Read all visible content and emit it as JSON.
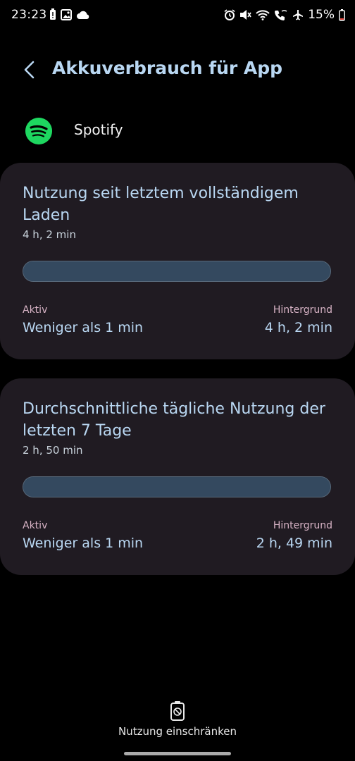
{
  "status_bar": {
    "time": "23:23",
    "battery_percent": "15%",
    "icons_left": [
      "battery-alert-icon",
      "image-icon",
      "cloud-icon"
    ],
    "icons_right": [
      "alarm-icon",
      "mute-icon",
      "wifi-icon",
      "wifi-calling-icon",
      "airplane-icon",
      "battery-icon"
    ]
  },
  "header": {
    "title": "Akkuverbrauch für App"
  },
  "app": {
    "name": "Spotify",
    "icon": "spotify-icon",
    "brand_color": "#1ed760"
  },
  "cards": [
    {
      "heading": "Nutzung seit letztem vollständigem Laden",
      "total": "4 h, 2 min",
      "active_label": "Aktiv",
      "active_value": "Weniger als 1 min",
      "background_label": "Hintergrund",
      "background_value": "4 h, 2 min"
    },
    {
      "heading": "Durchschnittliche tägliche Nutzung der letzten 7 Tage",
      "total": "2 h, 50 min",
      "active_label": "Aktiv",
      "active_value": "Weniger als 1 min",
      "background_label": "Hintergrund",
      "background_value": "2 h, 49 min"
    }
  ],
  "bottom_action": {
    "label": "Nutzung einschränken",
    "icon": "battery-restrict-icon"
  },
  "colors": {
    "accent": "#b9d7f2",
    "card_background": "#201b22",
    "bar": "#34495f",
    "secondary_label": "#d7b3c5"
  }
}
